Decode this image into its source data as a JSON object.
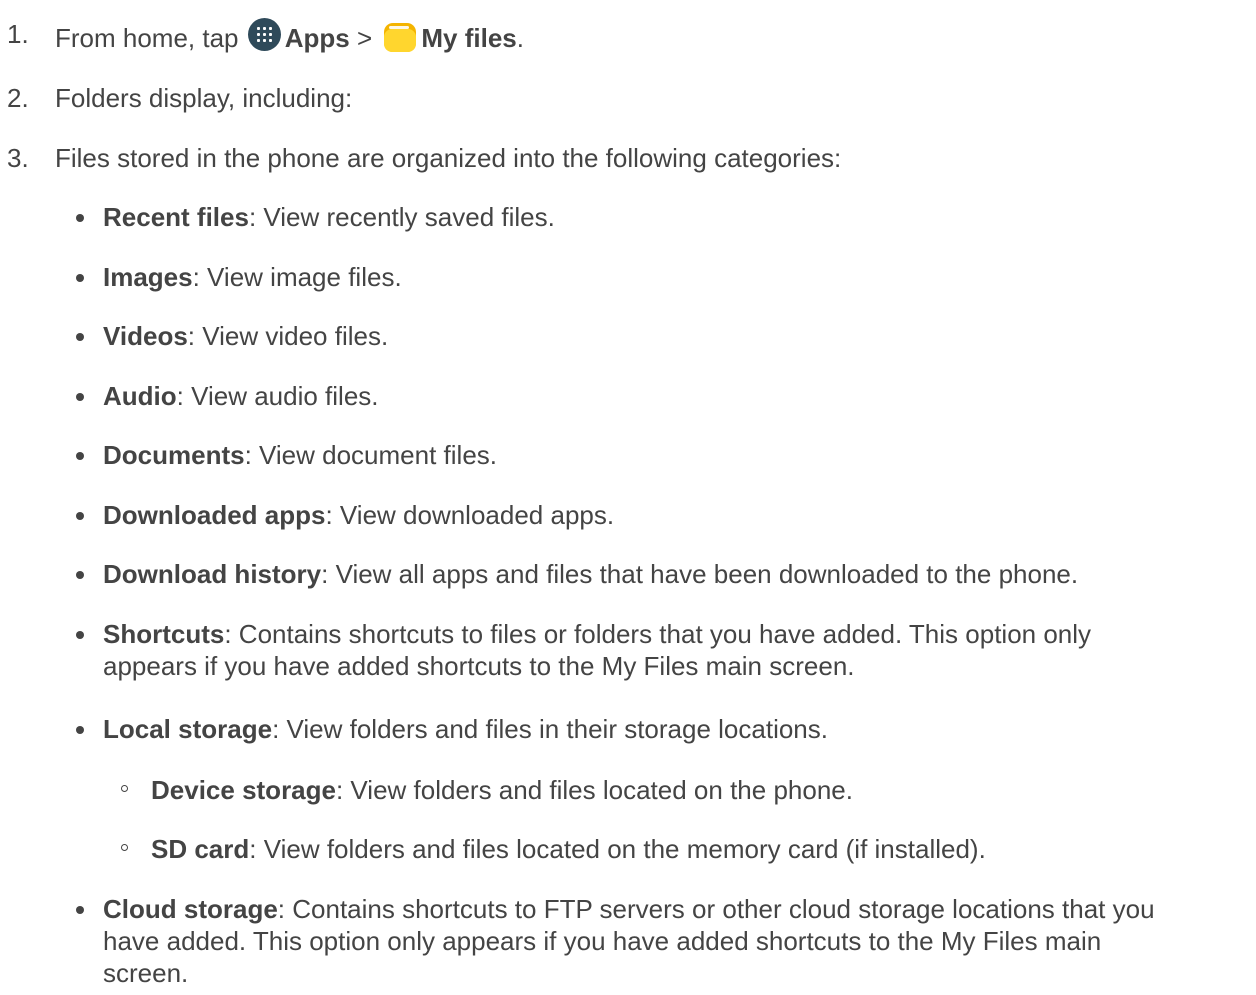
{
  "steps": [
    {
      "num": "1.",
      "prefix": "From home, tap ",
      "apps_label": "Apps",
      "sep": " > ",
      "myfiles_label": "My files",
      "suffix": "."
    },
    {
      "num": "2.",
      "text": "Folders display, including:"
    },
    {
      "num": "3.",
      "text": "Files stored in the phone are organized into the following categories:"
    }
  ],
  "icons": {
    "apps": "apps-grid-icon",
    "my_files": "folder-icon"
  },
  "categories": [
    {
      "name": "Recent files",
      "desc": ": View recently saved files."
    },
    {
      "name": "Images",
      "desc": ": View image files."
    },
    {
      "name": "Videos",
      "desc": ": View video files."
    },
    {
      "name": "Audio",
      "desc": ": View audio files."
    },
    {
      "name": "Documents",
      "desc": ": View document files."
    },
    {
      "name": "Downloaded apps",
      "desc": ": View downloaded apps."
    },
    {
      "name": "Download history",
      "desc": ": View all apps and files that have been downloaded to the phone."
    },
    {
      "name": "Shortcuts",
      "desc": ": Contains shortcuts to files or folders that you have added. This option only",
      "desc2": "appears if you have added shortcuts to the My Files main screen."
    },
    {
      "name": "Local storage",
      "desc": ": View folders and files in their storage locations."
    },
    {
      "name": "Cloud storage",
      "desc": ": Contains shortcuts to FTP servers or other cloud storage locations that you",
      "desc2": "have added. This option only appears if you have added shortcuts to the My Files main",
      "desc3": "screen."
    }
  ],
  "local_storage_items": [
    {
      "name": "Device storage",
      "desc": ": View folders and files located on the phone."
    },
    {
      "name": "SD card",
      "desc": ": View folders and files located on the memory card (if installed)."
    }
  ],
  "colors": {
    "text": "#444444",
    "apps_icon": "#2f4a5a",
    "folder_icon": "#ffd62e"
  }
}
